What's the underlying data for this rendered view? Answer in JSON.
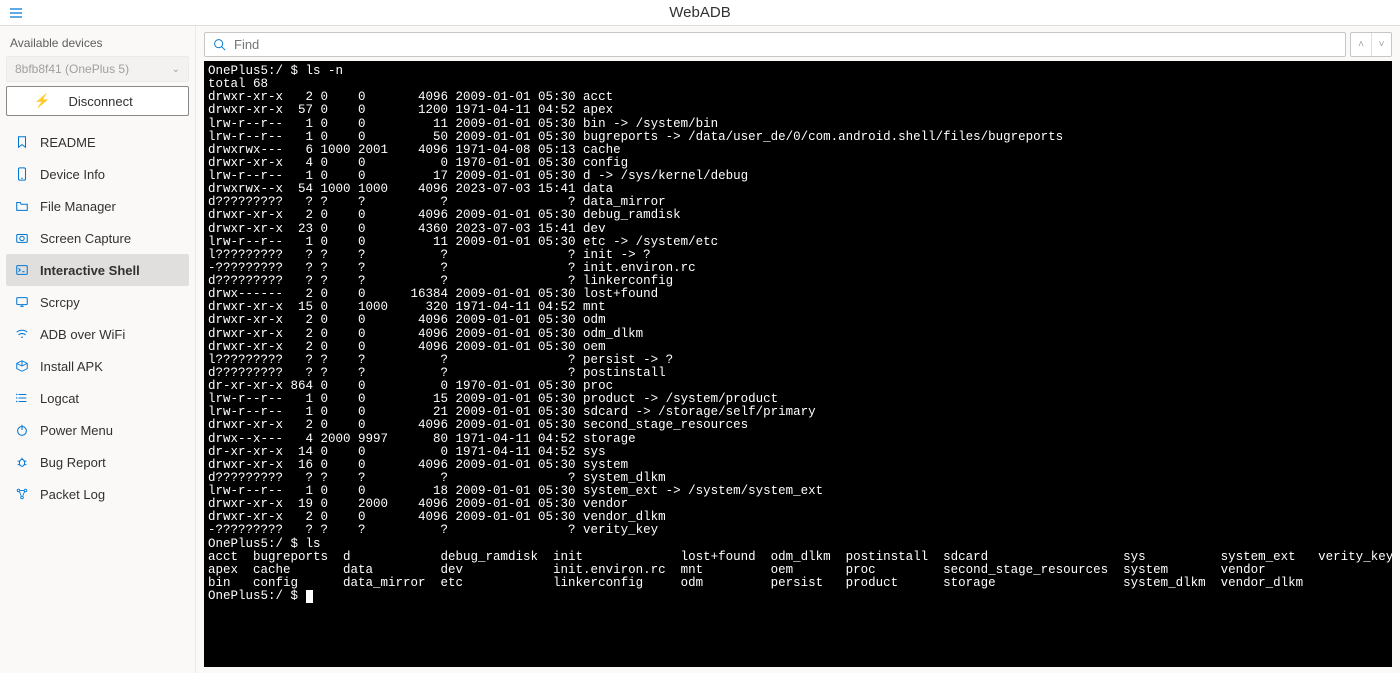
{
  "header": {
    "title": "WebADB"
  },
  "sidebar": {
    "available_label": "Available devices",
    "selected_device": "8bfb8f41 (OnePlus 5)",
    "disconnect_label": "Disconnect",
    "items": [
      {
        "icon": "bookmark",
        "label": "README"
      },
      {
        "icon": "phone",
        "label": "Device Info"
      },
      {
        "icon": "folder",
        "label": "File Manager"
      },
      {
        "icon": "camera",
        "label": "Screen Capture"
      },
      {
        "icon": "terminal",
        "label": "Interactive Shell",
        "active": true
      },
      {
        "icon": "monitor",
        "label": "Scrcpy"
      },
      {
        "icon": "wifi",
        "label": "ADB over WiFi"
      },
      {
        "icon": "package",
        "label": "Install APK"
      },
      {
        "icon": "list",
        "label": "Logcat"
      },
      {
        "icon": "power",
        "label": "Power Menu"
      },
      {
        "icon": "bug",
        "label": "Bug Report"
      },
      {
        "icon": "network",
        "label": "Packet Log"
      }
    ]
  },
  "find": {
    "placeholder": "Find"
  },
  "terminal": {
    "lines": [
      "OnePlus5:/ $ ls -n",
      "total 68",
      "drwxr-xr-x   2 0    0       4096 2009-01-01 05:30 acct",
      "drwxr-xr-x  57 0    0       1200 1971-04-11 04:52 apex",
      "lrw-r--r--   1 0    0         11 2009-01-01 05:30 bin -> /system/bin",
      "lrw-r--r--   1 0    0         50 2009-01-01 05:30 bugreports -> /data/user_de/0/com.android.shell/files/bugreports",
      "drwxrwx---   6 1000 2001    4096 1971-04-08 05:13 cache",
      "drwxr-xr-x   4 0    0          0 1970-01-01 05:30 config",
      "lrw-r--r--   1 0    0         17 2009-01-01 05:30 d -> /sys/kernel/debug",
      "drwxrwx--x  54 1000 1000    4096 2023-07-03 15:41 data",
      "d?????????   ? ?    ?          ?                ? data_mirror",
      "drwxr-xr-x   2 0    0       4096 2009-01-01 05:30 debug_ramdisk",
      "drwxr-xr-x  23 0    0       4360 2023-07-03 15:41 dev",
      "lrw-r--r--   1 0    0         11 2009-01-01 05:30 etc -> /system/etc",
      "l?????????   ? ?    ?          ?                ? init -> ?",
      "-?????????   ? ?    ?          ?                ? init.environ.rc",
      "d?????????   ? ?    ?          ?                ? linkerconfig",
      "drwx------   2 0    0      16384 2009-01-01 05:30 lost+found",
      "drwxr-xr-x  15 0    1000     320 1971-04-11 04:52 mnt",
      "drwxr-xr-x   2 0    0       4096 2009-01-01 05:30 odm",
      "drwxr-xr-x   2 0    0       4096 2009-01-01 05:30 odm_dlkm",
      "drwxr-xr-x   2 0    0       4096 2009-01-01 05:30 oem",
      "l?????????   ? ?    ?          ?                ? persist -> ?",
      "d?????????   ? ?    ?          ?                ? postinstall",
      "dr-xr-xr-x 864 0    0          0 1970-01-01 05:30 proc",
      "lrw-r--r--   1 0    0         15 2009-01-01 05:30 product -> /system/product",
      "lrw-r--r--   1 0    0         21 2009-01-01 05:30 sdcard -> /storage/self/primary",
      "drwxr-xr-x   2 0    0       4096 2009-01-01 05:30 second_stage_resources",
      "drwx--x---   4 2000 9997      80 1971-04-11 04:52 storage",
      "dr-xr-xr-x  14 0    0          0 1971-04-11 04:52 sys",
      "drwxr-xr-x  16 0    0       4096 2009-01-01 05:30 system",
      "d?????????   ? ?    ?          ?                ? system_dlkm",
      "lrw-r--r--   1 0    0         18 2009-01-01 05:30 system_ext -> /system/system_ext",
      "drwxr-xr-x  19 0    2000    4096 2009-01-01 05:30 vendor",
      "drwxr-xr-x   2 0    0       4096 2009-01-01 05:30 vendor_dlkm",
      "-?????????   ? ?    ?          ?                ? verity_key",
      "OnePlus5:/ $ ls",
      "acct  bugreports  d            debug_ramdisk  init             lost+found  odm_dlkm  postinstall  sdcard                  sys          system_ext   verity_key",
      "apex  cache       data         dev            init.environ.rc  mnt         oem       proc         second_stage_resources  system       vendor",
      "bin   config      data_mirror  etc            linkerconfig     odm         persist   product      storage                 system_dlkm  vendor_dlkm",
      "OnePlus5:/ $ "
    ]
  }
}
